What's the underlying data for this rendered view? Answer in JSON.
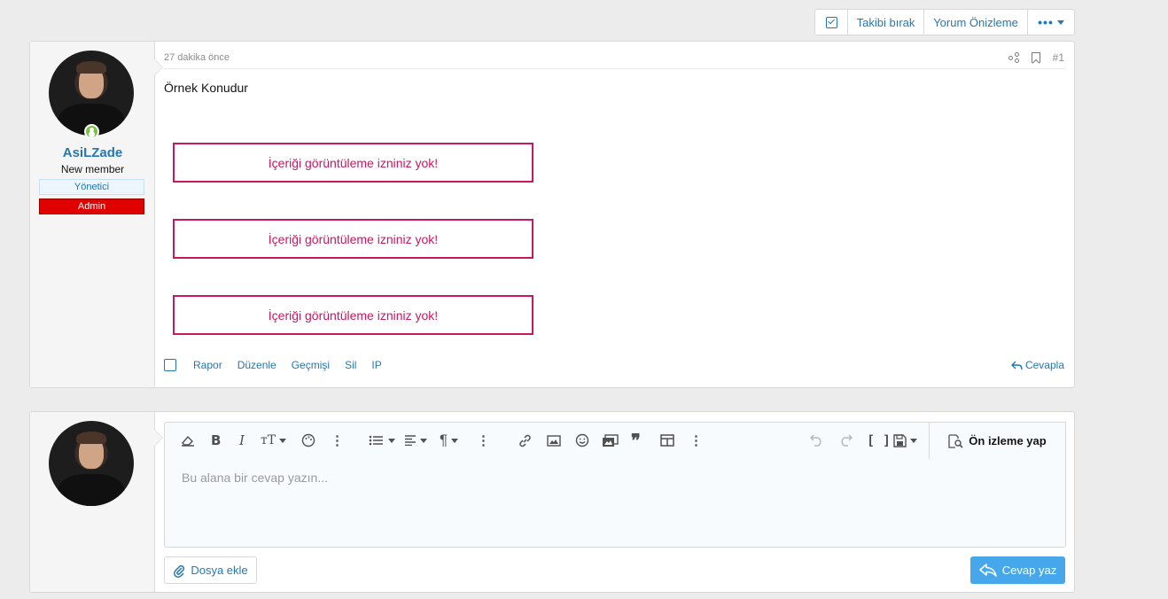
{
  "topbar": {
    "unfollow_label": "Takibi bırak",
    "preview_label": "Yorum Önizleme",
    "more_label": "•••"
  },
  "post": {
    "author": {
      "name": "AsiLZade",
      "title": "New member",
      "banner_staff": "Yönetici",
      "banner_admin": "Admin"
    },
    "time": "27 dakika önce",
    "number": "#1",
    "subject": "Örnek Konudur",
    "locked_messages": [
      "İçeriği görüntüleme izniniz yok!",
      "İçeriği görüntüleme izniniz yok!",
      "İçeriği görüntüleme izniniz yok!"
    ],
    "actions": [
      "Rapor",
      "Düzenle",
      "Geçmişi",
      "Sil",
      "IP"
    ],
    "reply_label": "Cevapla"
  },
  "reply": {
    "placeholder": "Bu alana bir cevap yazın...",
    "preview_button": "Ön izleme yap",
    "attach_label": "Dosya ekle",
    "submit_label": "Cevap yaz"
  },
  "colors": {
    "accent": "#2577b1",
    "locked": "#c8185f",
    "admin_banner": "#e00000",
    "submit": "#47a7eb"
  }
}
